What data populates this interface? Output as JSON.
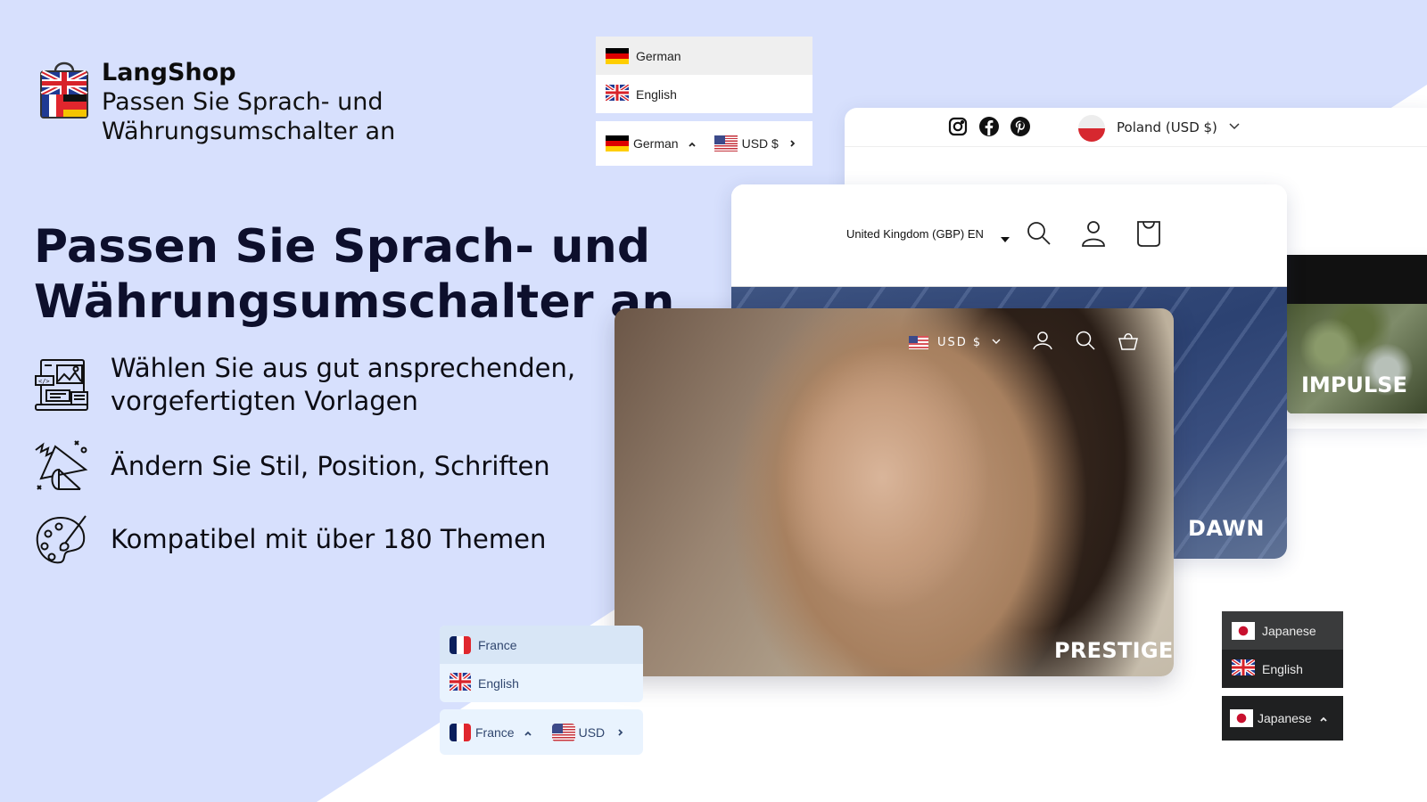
{
  "brand": {
    "name": "LangShop",
    "tagline_line1": "Passen Sie Sprach- und",
    "tagline_line2": "Währungsumschalter an",
    "logo_icon": "shopping-bag-flags-icon"
  },
  "headline": {
    "line1": "Passen Sie Sprach- und",
    "line2": "Währungsumschalter an"
  },
  "features": [
    {
      "icon": "templates-icon",
      "line1": "Wählen Sie aus gut ansprechenden,",
      "line2": "vorgefertigten Vorlagen"
    },
    {
      "icon": "style-shapes-icon",
      "line1": "Ändern Sie Stil, Position, Schriften"
    },
    {
      "icon": "palette-icon",
      "line1": "Kompatibel mit über 180 Themen"
    }
  ],
  "widget_german": {
    "options": [
      {
        "flag": "de",
        "label": "German",
        "active": true
      },
      {
        "flag": "gb",
        "label": "English",
        "active": false
      }
    ],
    "selected_language": "German",
    "selected_currency": "USD $",
    "currency_flag": "us"
  },
  "widget_france": {
    "options": [
      {
        "flag": "fr",
        "label": "France",
        "active": true
      },
      {
        "flag": "gb",
        "label": "English",
        "active": false
      }
    ],
    "selected_language": "France",
    "selected_currency": "USD",
    "currency_flag": "us"
  },
  "widget_japanese": {
    "options": [
      {
        "flag": "jp",
        "label": "Japanese",
        "active": true
      },
      {
        "flag": "gb",
        "label": "English",
        "active": false
      }
    ],
    "selected_language": "Japanese"
  },
  "store_poland": {
    "social": [
      "instagram-icon",
      "facebook-icon",
      "pinterest-icon"
    ],
    "country_selector": "Poland (USD $)"
  },
  "store_dawn": {
    "country_selector": "United Kingdom (GBP) EN",
    "theme_label": "DAWN"
  },
  "store_impulse": {
    "theme_label": "IMPULSE"
  },
  "store_prestige": {
    "currency_selector": "USD $",
    "theme_label": "PRESTIGE"
  },
  "colors": {
    "background": "#d7e0fd",
    "heading": "#0d0f2c",
    "french_widget": "#e9f3fe",
    "japanese_widget": "#222324"
  }
}
